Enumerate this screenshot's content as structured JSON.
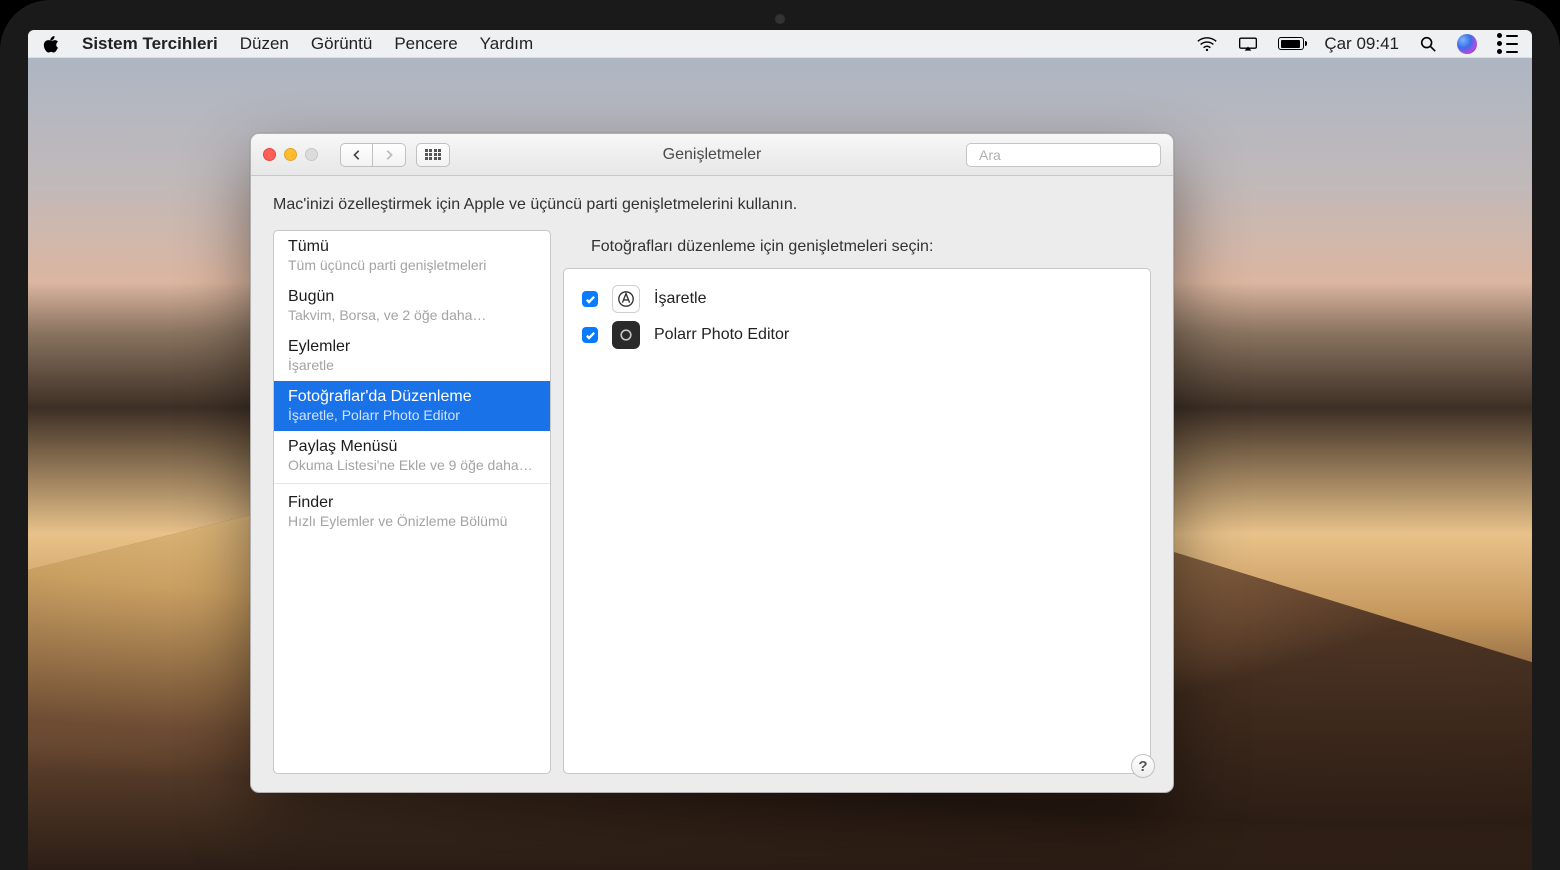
{
  "menubar": {
    "app_name": "Sistem Tercihleri",
    "items": [
      "Düzen",
      "Görüntü",
      "Pencere",
      "Yardım"
    ],
    "clock": "Çar 09:41"
  },
  "window": {
    "title": "Genişletmeler",
    "search_placeholder": "Ara",
    "description": "Mac'inizi özelleştirmek için Apple ve üçüncü parti genişletmelerini kullanın.",
    "help_label": "?"
  },
  "categories": [
    {
      "title": "Tümü",
      "subtitle": "Tüm üçüncü parti genişletmeleri",
      "selected": false
    },
    {
      "title": "Bugün",
      "subtitle": "Takvim, Borsa, ve 2 öğe daha…",
      "selected": false
    },
    {
      "title": "Eylemler",
      "subtitle": "İşaretle",
      "selected": false
    },
    {
      "title": "Fotoğraflar'da Düzenleme",
      "subtitle": "İşaretle, Polarr Photo Editor",
      "selected": true
    },
    {
      "title": "Paylaş Menüsü",
      "subtitle": "Okuma Listesi'ne Ekle ve 9 öğe daha…",
      "selected": false
    },
    {
      "title": "Finder",
      "subtitle": "Hızlı Eylemler ve Önizleme Bölümü",
      "selected": false
    }
  ],
  "right": {
    "heading": "Fotoğrafları düzenleme için genişletmeleri seçin:",
    "extensions": [
      {
        "name": "İşaretle",
        "checked": true,
        "icon": "markup"
      },
      {
        "name": "Polarr Photo Editor",
        "checked": true,
        "icon": "polarr"
      }
    ]
  }
}
